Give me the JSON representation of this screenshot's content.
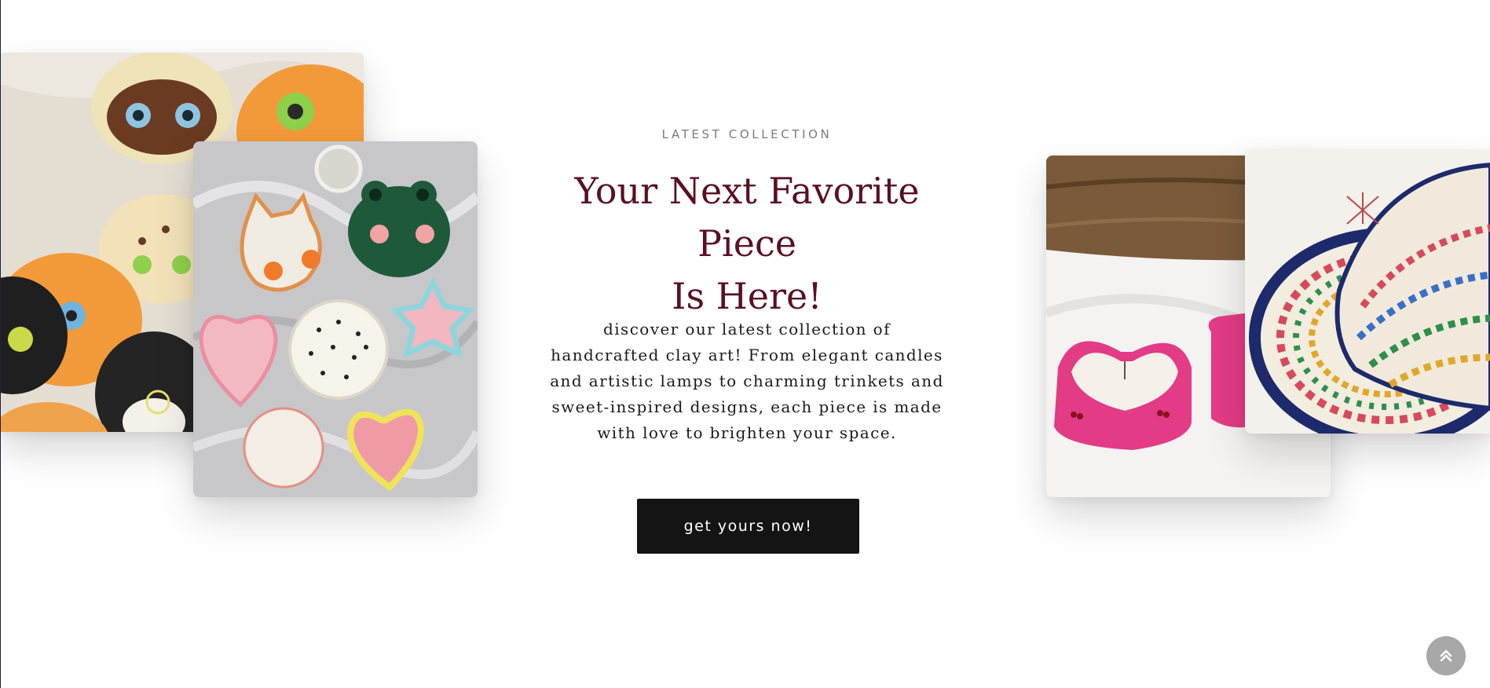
{
  "hero": {
    "eyebrow": "LATEST COLLECTION",
    "headline_line1": "Your Next Favorite Piece",
    "headline_line2": "Is Here!",
    "description": "discover our latest collection of handcrafted clay art! From elegant candles and artistic lamps to charming trinkets and sweet-inspired designs, each piece is made with love to brighten your space.",
    "cta_label": "get yours now!"
  },
  "images": {
    "left_back": "cat-face-clay-trinket-dishes-photo",
    "left_front": "frog-heart-star-clay-dishes-photo",
    "right_back": "pink-heart-clay-candles-photo",
    "right_front": "painted-ceramic-tagine-photo"
  },
  "icons": {
    "back_to_top": "double-chevron-up-icon"
  },
  "colors": {
    "headline": "#5a0f23",
    "button_bg": "#141414",
    "button_text": "#ffffff",
    "eyebrow": "#7a7a7a",
    "to_top_bg": "#a8a8a8"
  }
}
